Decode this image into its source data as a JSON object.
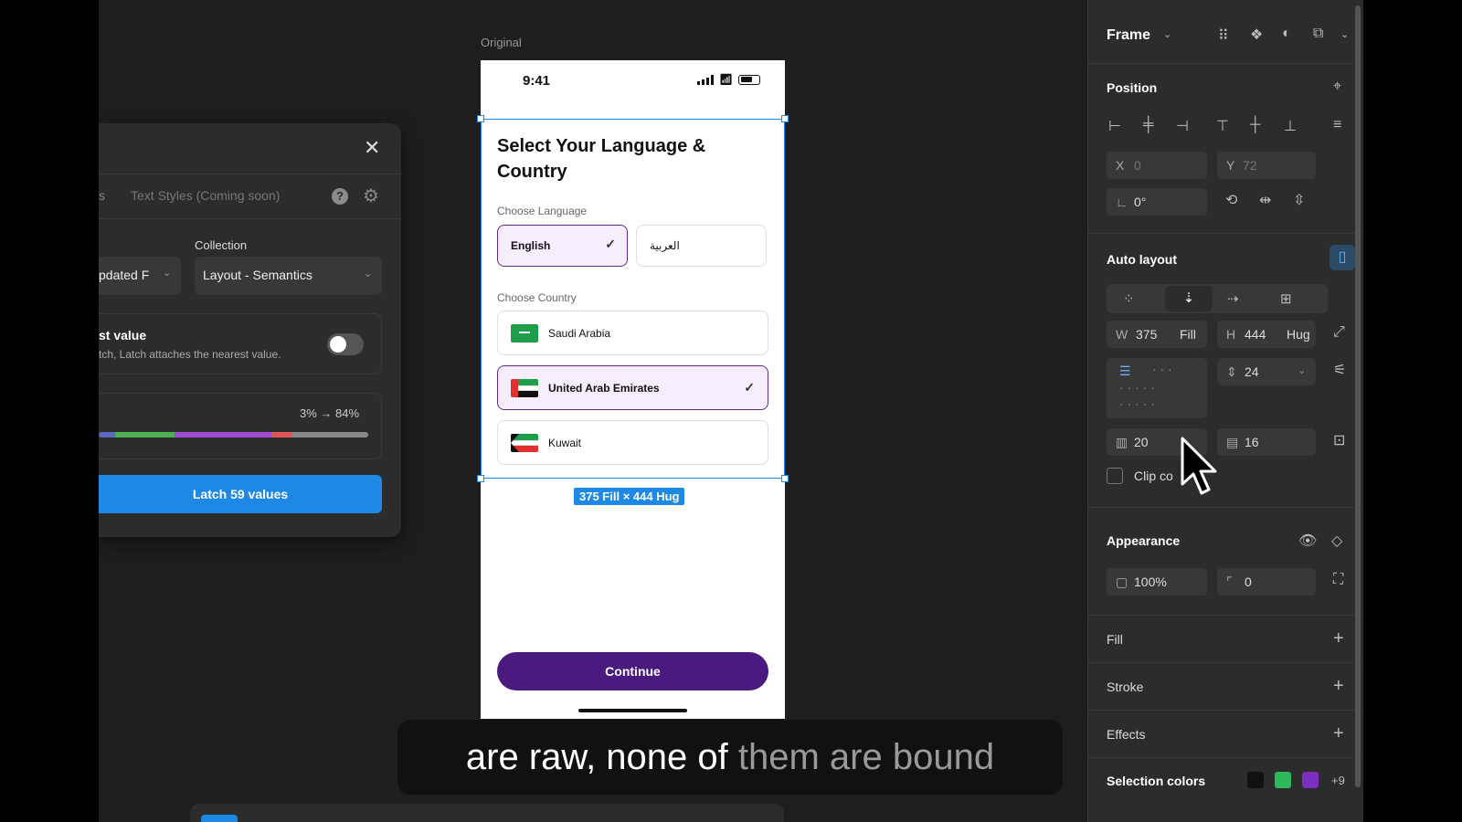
{
  "plugin": {
    "close_icon": "close-icon",
    "tab_partial": "s",
    "tab_text_styles": "Text Styles (Coming soon)",
    "help_icon": "help-icon",
    "settings_icon": "gear-icon",
    "collection_label": "Collection",
    "source_select": "pdated F",
    "collection_select": "Layout - Semantics",
    "option_title": "st value",
    "option_desc": "tch, Latch attaches the nearest value.",
    "option_toggle_on": false,
    "progress_text": "3% → 84%",
    "progress_segments": [
      {
        "color": "#5c6bc0",
        "share": 0.06
      },
      {
        "color": "#4caf50",
        "share": 0.22
      },
      {
        "color": "#9c4dcc",
        "share": 0.36
      },
      {
        "color": "#e05555",
        "share": 0.08
      },
      {
        "color": "#888888",
        "share": 0.28
      }
    ],
    "latch_button": "Latch 59 values"
  },
  "frame": {
    "label": "Original",
    "status_time": "9:41",
    "heading": "Select Your Language & Country",
    "choose_language": "Choose Language",
    "lang_selected": "English",
    "lang_alt": "العربية",
    "choose_country": "Choose Country",
    "countries": [
      {
        "name": "Saudi Arabia",
        "selected": false
      },
      {
        "name": "United Arab Emirates",
        "selected": true
      },
      {
        "name": "Kuwait",
        "selected": false
      }
    ],
    "continue_button": "Continue",
    "dimension_badge": "375 Fill × 444 Hug"
  },
  "caption": {
    "spoken": "are raw, none of ",
    "upcoming": "them are bound"
  },
  "inspector": {
    "frame_title": "Frame",
    "position_title": "Position",
    "x_label": "X",
    "x_value": "0",
    "y_label": "Y",
    "y_value": "72",
    "rotation_value": "0°",
    "autolayout_title": "Auto layout",
    "w_label": "W",
    "w_value": "375",
    "w_mode": "Fill",
    "h_label": "H",
    "h_value": "444",
    "h_mode": "Hug",
    "gap_value": "24",
    "padding_h": "20",
    "padding_v": "16",
    "clip_label": "Clip co",
    "appearance_title": "Appearance",
    "opacity_value": "100%",
    "radius_value": "0",
    "fill_title": "Fill",
    "stroke_title": "Stroke",
    "effects_title": "Effects",
    "selection_colors_title": "Selection colors",
    "selection_colors": [
      "#111111",
      "#2eb85c",
      "#7b2fbe"
    ],
    "selection_more": "+9"
  }
}
